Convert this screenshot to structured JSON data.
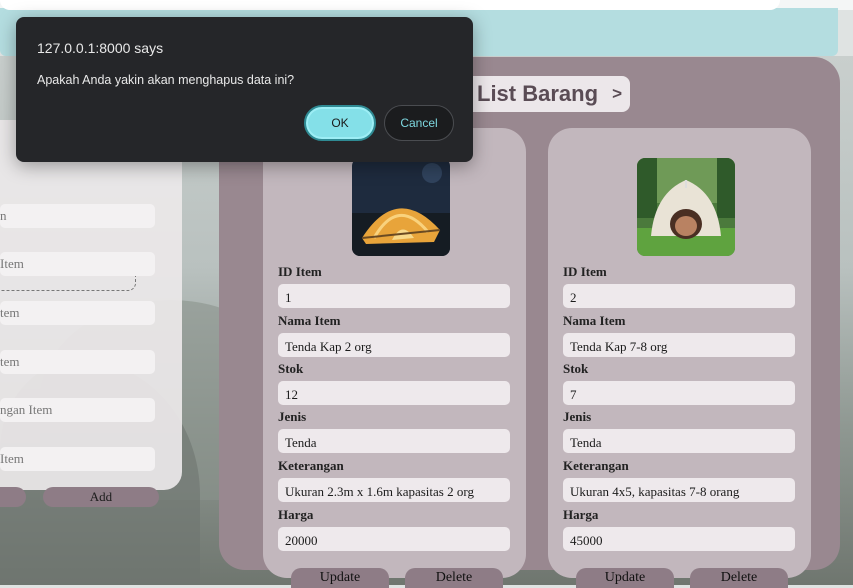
{
  "dialog": {
    "origin": "127.0.0.1:8000 says",
    "message": "Apakah Anda yakin akan menghapus data ini?",
    "ok_label": "OK",
    "cancel_label": "Cancel"
  },
  "list": {
    "title": "List Barang",
    "chevron": ">"
  },
  "form": {
    "fields": [
      "n",
      "Item",
      "tem",
      "tem",
      "ngan Item",
      "Item"
    ],
    "add_label": "Add"
  },
  "labels": {
    "id": "ID Item",
    "nama": "Nama Item",
    "stok": "Stok",
    "jenis": "Jenis",
    "keterangan": "Keterangan",
    "harga": "Harga"
  },
  "items": [
    {
      "id": "1",
      "nama": "Tenda Kap 2 org",
      "stok": "12",
      "jenis": "Tenda",
      "keterangan": "Ukuran 2.3m x 1.6m kapasitas 2 org",
      "harga": "20000",
      "update_label": "Update",
      "delete_label": "Delete"
    },
    {
      "id": "2",
      "nama": "Tenda Kap 7-8 org",
      "stok": "7",
      "jenis": "Tenda",
      "keterangan": "Ukuran 4x5, kapasitas 7-8 orang",
      "harga": "45000",
      "update_label": "Update",
      "delete_label": "Delete"
    }
  ],
  "colors": {
    "panel": "#998890",
    "card": "#c2b7bd",
    "button": "#8e7c86",
    "ok_accent": "#84e0e8"
  }
}
